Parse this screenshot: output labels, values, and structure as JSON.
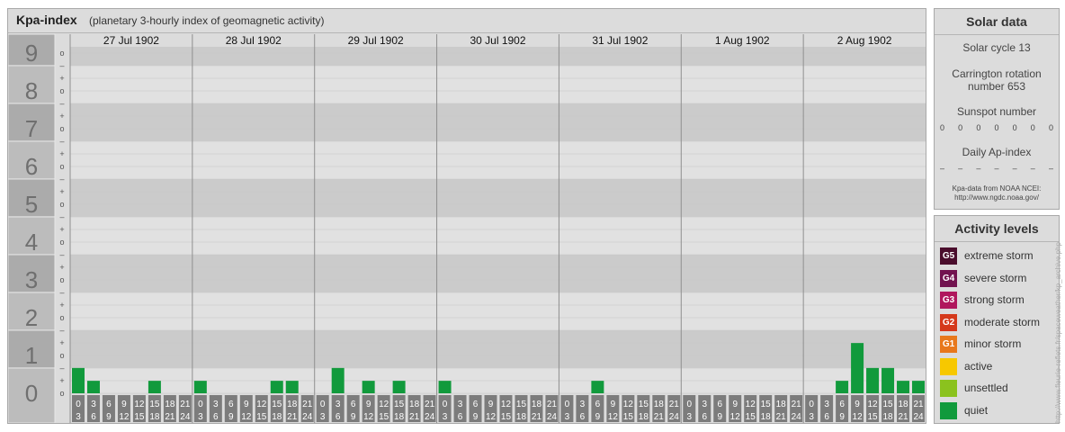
{
  "header": {
    "title": "Kpa-index",
    "subtitle": "(planetary 3-hourly index of geomagnetic activity)"
  },
  "chart_data": {
    "type": "bar",
    "y_levels": [
      "0",
      "1",
      "2",
      "3",
      "4",
      "5",
      "6",
      "7",
      "8",
      "9"
    ],
    "y_minor_marks": [
      "o",
      "+",
      "–",
      "o",
      "+",
      "–",
      "o",
      "+",
      "–",
      "o",
      "+",
      "–",
      "o",
      "+",
      "–",
      "o",
      "+",
      "–",
      "o",
      "+",
      "–",
      "o",
      "+",
      "–",
      "o",
      "+",
      "–",
      "o",
      "–"
    ],
    "ylim": [
      0,
      9.33
    ],
    "days": [
      "27 Jul 1902",
      "28 Jul 1902",
      "29 Jul 1902",
      "30 Jul 1902",
      "31 Jul 1902",
      "1 Aug 1902",
      "2 Aug 1902"
    ],
    "interval_labels": [
      [
        "0",
        "3"
      ],
      [
        "3",
        "6"
      ],
      [
        "6",
        "9"
      ],
      [
        "9",
        "12"
      ],
      [
        "12",
        "15"
      ],
      [
        "15",
        "18"
      ],
      [
        "18",
        "21"
      ],
      [
        "21",
        "24"
      ]
    ],
    "values": [
      [
        0.67,
        0.33,
        0,
        0,
        0,
        0.33,
        0,
        0
      ],
      [
        0.33,
        0,
        0,
        0,
        0,
        0.33,
        0.33,
        0
      ],
      [
        0,
        0.67,
        0,
        0.33,
        0,
        0.33,
        0,
        0
      ],
      [
        0.33,
        0,
        0,
        0,
        0,
        0,
        0,
        0
      ],
      [
        0,
        0,
        0.33,
        0,
        0,
        0,
        0,
        0
      ],
      [
        0,
        0,
        0,
        0,
        0,
        0,
        0,
        0
      ],
      [
        0,
        0,
        0.33,
        1.33,
        0.67,
        0.67,
        0.33,
        0.33
      ]
    ],
    "bar_color": "#119a3c"
  },
  "solar_data": {
    "title": "Solar data",
    "cycle": "Solar cycle 13",
    "carrington_line1": "Carrington rotation",
    "carrington_line2": "number 653",
    "sunspot_label": "Sunspot number",
    "sunspot_values": [
      "0",
      "0",
      "0",
      "0",
      "0",
      "0",
      "0"
    ],
    "ap_label": "Daily Ap-index",
    "ap_values": [
      "–",
      "–",
      "–",
      "–",
      "–",
      "–",
      "–"
    ],
    "credit_line1": "Kpa-data from NOAA NCEI:",
    "credit_line2": "http://www.ngdc.noaa.gov/"
  },
  "activity_levels": {
    "title": "Activity levels",
    "items": [
      {
        "code": "G5",
        "label": "extreme storm",
        "color": "#4a0d2c"
      },
      {
        "code": "G4",
        "label": "severe storm",
        "color": "#72134f"
      },
      {
        "code": "G3",
        "label": "strong storm",
        "color": "#b0175d"
      },
      {
        "code": "G2",
        "label": "moderate storm",
        "color": "#d5391b"
      },
      {
        "code": "G1",
        "label": "minor storm",
        "color": "#e8781c"
      },
      {
        "code": "",
        "label": "active",
        "color": "#f7c800"
      },
      {
        "code": "",
        "label": "unsettled",
        "color": "#8bc21e"
      },
      {
        "code": "",
        "label": "quiet",
        "color": "#119a3c"
      }
    ]
  },
  "watermark": "http://www.fleurie-reflets.fr/spaceweather/kp_archive.php"
}
